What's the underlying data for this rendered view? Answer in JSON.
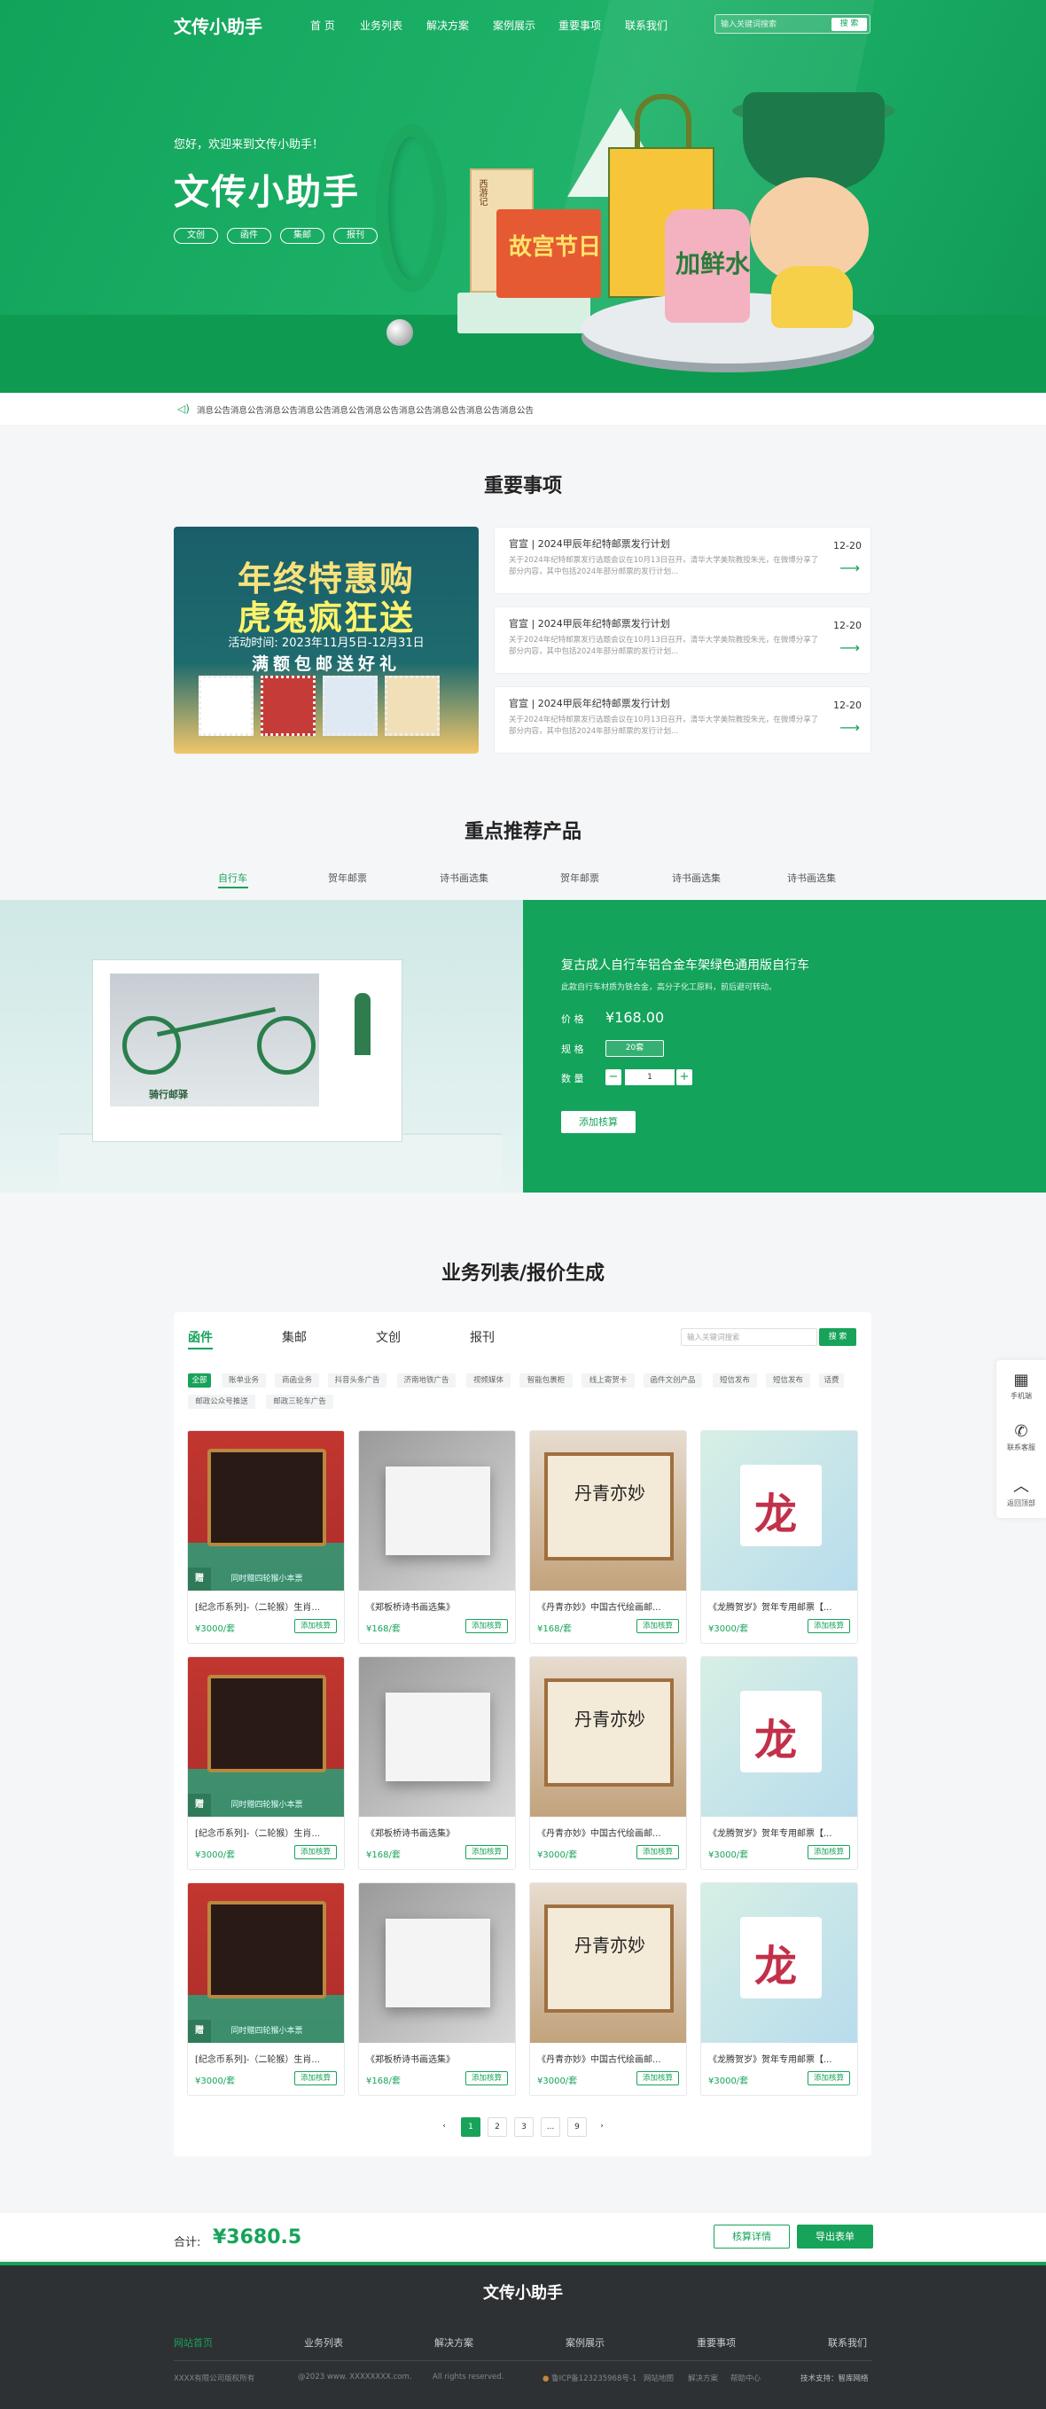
{
  "header": {
    "logo": "文传小助手",
    "nav": [
      "首 页",
      "业务列表",
      "解决方案",
      "案例展示",
      "重要事项",
      "联系我们"
    ],
    "search_placeholder": "输入关键词搜索",
    "search_button": "搜 索"
  },
  "hero": {
    "welcome": "您好，欢迎来到文传小助手！",
    "title": "文传小助手",
    "pills": [
      "文创",
      "函件",
      "集邮",
      "报刊"
    ],
    "book1_text": "西游记",
    "book2_text": "故宫节日",
    "bottle_text": "加鲜水"
  },
  "notice": {
    "icon": "speaker-icon",
    "text": "消息公告消息公告消息公告消息公告消息公告消息公告消息公告消息公告消息公告消息公告"
  },
  "important": {
    "title": "重要事项",
    "promo": {
      "line1": "年终特惠购",
      "line2": "虎兔疯狂送",
      "date": "活动时间: 2023年11月5日-12月31日",
      "line3": "满额包邮送好礼"
    },
    "news": [
      {
        "title": "官宣 | 2024甲辰年纪特邮票发行计划",
        "desc": "关于2024年纪特邮票发行选题会议在10月13日召开。清华大学美院教授朱光，在微博分享了部分内容，其中包括2024年部分邮票的发行计划...",
        "date": "12-20"
      },
      {
        "title": "官宣 | 2024甲辰年纪特邮票发行计划",
        "desc": "关于2024年纪特邮票发行选题会议在10月13日召开。清华大学美院教授朱光，在微博分享了部分内容，其中包括2024年部分邮票的发行计划...",
        "date": "12-20"
      },
      {
        "title": "官宣 | 2024甲辰年纪特邮票发行计划",
        "desc": "关于2024年纪特邮票发行选题会议在10月13日召开。清华大学美院教授朱光，在微博分享了部分内容，其中包括2024年部分邮票的发行计划...",
        "date": "12-20"
      }
    ]
  },
  "recommend": {
    "title": "重点推荐产品",
    "tabs": [
      "自行车",
      "贺年邮票",
      "诗书画选集",
      "贺年邮票",
      "诗书画选集",
      "诗书画选集"
    ],
    "active_tab": 0,
    "box_text": "骑行邮驿",
    "product": {
      "name": "复古成人自行车铝合金车架绿色通用版自行车",
      "desc": "此款自行车材质为铁合金，高分子化工原料，前后避可转动。",
      "price_label": "价 格",
      "price": "¥168.00",
      "spec_label": "规 格",
      "spec": "20套",
      "qty_label": "数 量",
      "qty": "1",
      "minus": "−",
      "plus": "+",
      "add_button": "添加核算"
    }
  },
  "business": {
    "title": "业务列表/报价生成",
    "tabs": [
      "函件",
      "集邮",
      "文创",
      "报刊"
    ],
    "active_tab": 0,
    "search_placeholder": "输入关键词搜索",
    "search_button": "搜 索",
    "filters": [
      "全部",
      "账单业务",
      "商函业务",
      "抖音头条广告",
      "济南地铁广告",
      "视频媒体",
      "智能包裹柜",
      "线上寄贺卡",
      "函件文创产品",
      "短信发布",
      "短信发布",
      "话费",
      "邮政公众号推送",
      "邮政三轮车广告"
    ],
    "active_filter": 0,
    "products": [
      {
        "title": "[纪念币系列]-（二轮猴）生肖...",
        "price": "¥3000/套",
        "button": "添加核算",
        "ribbon_tag": "赠",
        "ribbon": "同时赠四轮猴小本票"
      },
      {
        "title": "《郑板桥诗书画选集》",
        "price": "¥168/套",
        "button": "添加核算"
      },
      {
        "title": "《丹青亦妙》中国古代绘画邮...",
        "price": "¥168/套",
        "button": "添加核算",
        "art_text": "丹青亦妙"
      },
      {
        "title": "《龙腾贺岁》贺年专用邮票【...",
        "price": "¥3000/套",
        "button": "添加核算",
        "art_text": "龙"
      },
      {
        "title": "[纪念币系列]-（二轮猴）生肖...",
        "price": "¥3000/套",
        "button": "添加核算",
        "ribbon_tag": "赠",
        "ribbon": "同时赠四轮猴小本票"
      },
      {
        "title": "《郑板桥诗书画选集》",
        "price": "¥168/套",
        "button": "添加核算"
      },
      {
        "title": "《丹青亦妙》中国古代绘画邮...",
        "price": "¥3000/套",
        "button": "添加核算",
        "art_text": "丹青亦妙"
      },
      {
        "title": "《龙腾贺岁》贺年专用邮票【...",
        "price": "¥3000/套",
        "button": "添加核算",
        "art_text": "龙"
      },
      {
        "title": "[纪念币系列]-（二轮猴）生肖...",
        "price": "¥3000/套",
        "button": "添加核算",
        "ribbon_tag": "赠",
        "ribbon": "同时赠四轮猴小本票"
      },
      {
        "title": "《郑板桥诗书画选集》",
        "price": "¥168/套",
        "button": "添加核算"
      },
      {
        "title": "《丹青亦妙》中国古代绘画邮...",
        "price": "¥3000/套",
        "button": "添加核算",
        "art_text": "丹青亦妙"
      },
      {
        "title": "《龙腾贺岁》贺年专用邮票【...",
        "price": "¥3000/套",
        "button": "添加核算",
        "art_text": "龙"
      }
    ],
    "pagination": [
      "‹",
      "1",
      "2",
      "3",
      "...",
      "9",
      "›"
    ],
    "active_page": "1"
  },
  "float_bar": [
    {
      "icon": "qrcode-icon",
      "label": "手机端"
    },
    {
      "icon": "phone-icon",
      "label": "联系客服"
    },
    {
      "icon": "back-to-top-icon",
      "label": "返回顶部"
    }
  ],
  "total": {
    "label": "合计:",
    "value": "¥3680.5",
    "detail_button": "核算详情",
    "export_button": "导出表单"
  },
  "footer": {
    "title": "文传小助手",
    "links": [
      "网站首页",
      "业务列表",
      "解决方案",
      "案例展示",
      "重要事项",
      "联系我们"
    ],
    "company": "XXXX有限公司版权所有",
    "copyright": "@2023 www. XXXXXXXX.com.",
    "rights": "All rights reserved.",
    "icp": "鲁ICP备123235968号-1",
    "legal_links": [
      "网站地图",
      "解决方案",
      "帮助中心"
    ],
    "support": "技术支持：智库网络"
  },
  "colors": {
    "accent": "#17a35a",
    "footer_bg": "#2e3134"
  }
}
